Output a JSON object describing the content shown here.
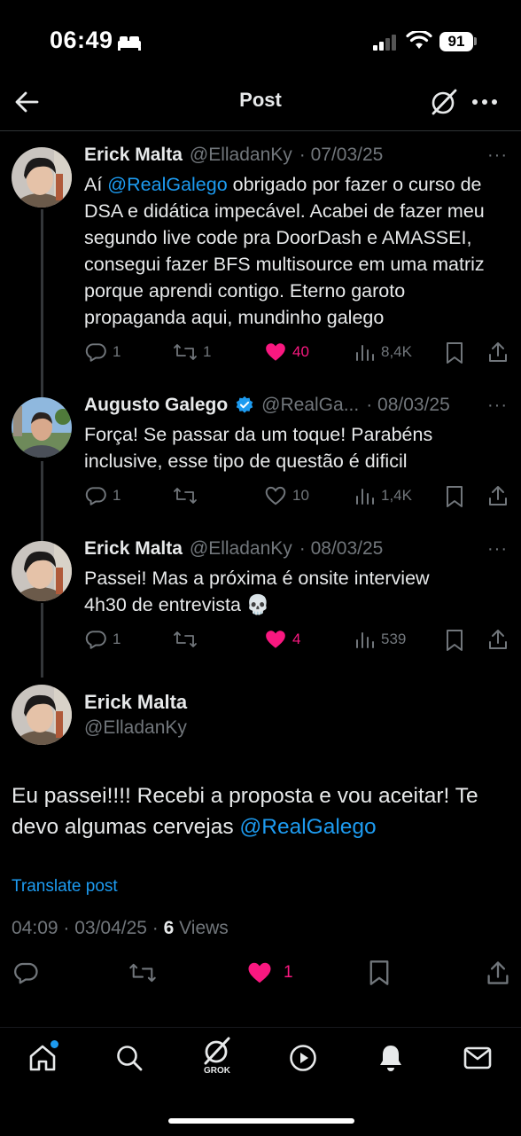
{
  "status_bar": {
    "time": "06:49",
    "battery": "91"
  },
  "header": {
    "title": "Post"
  },
  "tweets": [
    {
      "name": "Erick Malta",
      "handle": "@ElladanKy",
      "date": "· 07/03/25",
      "text_prefix": "Aí ",
      "mention": "@RealGalego",
      "text_suffix": " obrigado por fazer o curso de DSA e didática impecável. Acabei de fazer meu segundo live code pra DoorDash e AMASSEI, consegui fazer BFS multisource em uma matriz porque aprendi contigo. Eterno garoto propaganda aqui, mundinho galego",
      "replies": "1",
      "reposts": "1",
      "likes": "40",
      "views": "8,4K"
    },
    {
      "name": "Augusto Galego",
      "handle": "@RealGa...",
      "date": "· 08/03/25",
      "text": "Força! Se passar da um toque! Parabéns inclusive, esse tipo de questão é dificil",
      "replies": "1",
      "reposts": "",
      "likes": "10",
      "views": "1,4K"
    },
    {
      "name": "Erick Malta",
      "handle": "@ElladanKy",
      "date": "· 08/03/25",
      "text": "Passei! Mas a próxima é onsite interview 4h30 de entrevista 💀",
      "replies": "1",
      "reposts": "",
      "likes": "4",
      "views": "539"
    }
  ],
  "main_post": {
    "name": "Erick Malta",
    "handle": "@ElladanKy",
    "text_prefix": "Eu passei!!!! Recebi a proposta e vou aceitar! Te devo algumas cervejas ",
    "mention": "@RealGalego",
    "translate": "Translate post",
    "time": "04:09 · 03/04/25 · ",
    "views_count": "6",
    "views_label": " Views",
    "likes": "1"
  },
  "tabbar": {
    "grok_label": "GROK"
  },
  "colors": {
    "accent": "#1d9bf0",
    "like": "#f91880",
    "muted": "#71767b"
  }
}
